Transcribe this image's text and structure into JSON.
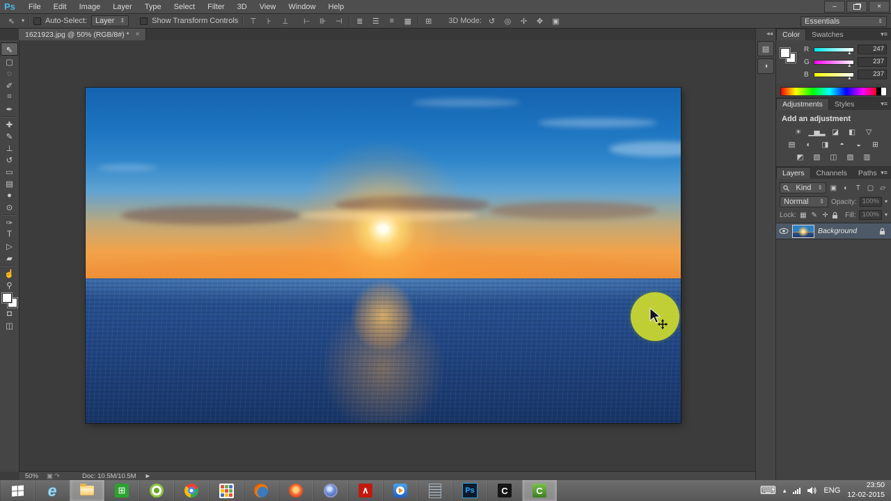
{
  "app": {
    "logo": "Ps"
  },
  "colors": {
    "cursor_halo": "#ccd92f",
    "ps_logo_blue": "#4db6e8",
    "selected_layer_bg": "#4d5966",
    "taskbar_gray": "#5f5f5f"
  },
  "window_controls": {
    "minimize": "–",
    "close": "×"
  },
  "menu_bar": {
    "items": [
      "File",
      "Edit",
      "Image",
      "Layer",
      "Type",
      "Select",
      "Filter",
      "3D",
      "View",
      "Window",
      "Help"
    ]
  },
  "options_bar": {
    "tool_glyph": "⇖",
    "tool_dropdown_glyph": "▾",
    "auto_select_label": "Auto-Select:",
    "auto_select_value": "Layer",
    "show_transform_label": "Show Transform Controls",
    "align_icons_v": [
      {
        "name": "align-top-edges",
        "glyph": "⊤"
      },
      {
        "name": "align-vertical-centers",
        "glyph": "⊦"
      },
      {
        "name": "align-bottom-edges",
        "glyph": "⊥"
      }
    ],
    "align_icons_h": [
      {
        "name": "align-left-edges",
        "glyph": "⊢"
      },
      {
        "name": "align-horizontal-centers",
        "glyph": "⊪"
      },
      {
        "name": "align-right-edges",
        "glyph": "⊣"
      }
    ],
    "distribute_icons": [
      {
        "name": "distribute-top-edges",
        "glyph": "≣"
      },
      {
        "name": "distribute-vertical-centers",
        "glyph": "☰"
      },
      {
        "name": "distribute-bottom-edges",
        "glyph": "≡"
      },
      {
        "name": "distribute-left-edges",
        "glyph": "▦"
      }
    ],
    "auto_align_icon": {
      "name": "auto-align-layers",
      "glyph": "⊞"
    },
    "mode_label": "3D Mode:",
    "mode_icons": [
      {
        "name": "3d-orbit",
        "glyph": "↺"
      },
      {
        "name": "3d-roll",
        "glyph": "◎"
      },
      {
        "name": "3d-drag",
        "glyph": "✢"
      },
      {
        "name": "3d-slide",
        "glyph": "✥"
      },
      {
        "name": "3d-scale",
        "glyph": "▣"
      }
    ],
    "workspace": "Essentials"
  },
  "document_tab": {
    "title": "1621923.jpg @ 50% (RGB/8#) *",
    "close_glyph": "×"
  },
  "toolbar": {
    "tools": [
      {
        "name": "move-tool",
        "glyph": "⇖",
        "selected": true
      },
      {
        "name": "rectangular-marquee-tool",
        "glyph": "▢"
      },
      {
        "name": "lasso-tool",
        "glyph": "◌"
      },
      {
        "name": "quick-selection-tool",
        "glyph": "✐"
      },
      {
        "name": "crop-tool",
        "glyph": "⌗"
      },
      {
        "name": "eyedropper-tool",
        "glyph": "✒"
      },
      {
        "name": "spot-healing-brush-tool",
        "glyph": "✚"
      },
      {
        "name": "brush-tool",
        "glyph": "✎"
      },
      {
        "name": "clone-stamp-tool",
        "glyph": "⊥"
      },
      {
        "name": "history-brush-tool",
        "glyph": "↺"
      },
      {
        "name": "eraser-tool",
        "glyph": "▭"
      },
      {
        "name": "gradient-tool",
        "glyph": "▤"
      },
      {
        "name": "blur-tool",
        "glyph": "●"
      },
      {
        "name": "dodge-tool",
        "glyph": "⊙"
      },
      {
        "name": "pen-tool",
        "glyph": "✑"
      },
      {
        "name": "type-tool",
        "glyph": "T"
      },
      {
        "name": "path-selection-tool",
        "glyph": "▷"
      },
      {
        "name": "rectangle-tool",
        "glyph": "▰"
      },
      {
        "name": "hand-tool",
        "glyph": "☝"
      },
      {
        "name": "zoom-tool",
        "glyph": "⚲"
      }
    ],
    "quick_mask_glyph": "◘",
    "screen_mode_glyph": "◫"
  },
  "dock_strip": {
    "collapse_glyph": "◂◂",
    "buttons": [
      {
        "name": "history-panel",
        "glyph": "▤"
      },
      {
        "name": "properties-panel",
        "glyph": "◑"
      }
    ]
  },
  "panels": {
    "color": {
      "tabs": [
        "Color",
        "Swatches"
      ],
      "menu_glyph": "▾≡",
      "channels": [
        {
          "label": "R",
          "value": "247"
        },
        {
          "label": "G",
          "value": "237"
        },
        {
          "label": "B",
          "value": "237"
        }
      ]
    },
    "adjustments": {
      "tabs": [
        "Adjustments",
        "Styles"
      ],
      "menu_glyph": "▾≡",
      "heading": "Add an adjustment",
      "rows": [
        [
          {
            "name": "brightness-contrast-adjustment",
            "glyph": "☀"
          },
          {
            "name": "levels-adjustment",
            "glyph": "▁▅▂"
          },
          {
            "name": "curves-adjustment",
            "glyph": "◪"
          },
          {
            "name": "exposure-adjustment",
            "glyph": "◧"
          },
          {
            "name": "vibrance-adjustment",
            "glyph": "▽"
          }
        ],
        [
          {
            "name": "hue-saturation-adjustment",
            "glyph": "▤"
          },
          {
            "name": "color-balance-adjustment",
            "glyph": "◐"
          },
          {
            "name": "black-white-adjustment",
            "glyph": "◨"
          },
          {
            "name": "photo-filter-adjustment",
            "glyph": "◓"
          },
          {
            "name": "channel-mixer-adjustment",
            "glyph": "◒"
          },
          {
            "name": "color-lookup-adjustment",
            "glyph": "⊞"
          }
        ],
        [
          {
            "name": "invert-adjustment",
            "glyph": "◩"
          },
          {
            "name": "posterize-adjustment",
            "glyph": "▧"
          },
          {
            "name": "threshold-adjustment",
            "glyph": "◫"
          },
          {
            "name": "selective-color-adjustment",
            "glyph": "▨"
          },
          {
            "name": "gradient-map-adjustment",
            "glyph": "▥"
          }
        ]
      ]
    },
    "layers": {
      "tabs": [
        "Layers",
        "Channels",
        "Paths"
      ],
      "menu_glyph": "▾≡",
      "filter_label": "Kind",
      "filter_icons": [
        {
          "name": "filter-pixel-layers",
          "glyph": "▣"
        },
        {
          "name": "filter-adjustment-layers",
          "glyph": "◐"
        },
        {
          "name": "filter-type-layers",
          "glyph": "T"
        },
        {
          "name": "filter-shape-layers",
          "glyph": "▢"
        },
        {
          "name": "filter-smart-objects",
          "glyph": "▱"
        }
      ],
      "blend_mode": "Normal",
      "opacity_label": "Opacity:",
      "opacity_value": "100%",
      "lock_label": "Lock:",
      "lock_icons": [
        {
          "name": "lock-transparent-pixels",
          "glyph": "▦"
        },
        {
          "name": "lock-image-pixels",
          "glyph": "✎"
        },
        {
          "name": "lock-position",
          "glyph": "✛"
        }
      ],
      "fill_label": "Fill:",
      "fill_value": "100%",
      "layer": {
        "name": "Background"
      }
    }
  },
  "status_bar": {
    "zoom": "50%",
    "doc": "Doc: 10.5M/10.5M",
    "expand_glyph": "►"
  },
  "taskbar": {
    "icons": [
      {
        "name": "start-button"
      },
      {
        "name": "internet-explorer",
        "glyph": "e"
      },
      {
        "name": "file-explorer",
        "active": true
      },
      {
        "name": "windows-store",
        "glyph": "⊞"
      },
      {
        "name": "green-circle-app"
      },
      {
        "name": "chrome"
      },
      {
        "name": "app-grid"
      },
      {
        "name": "firefox"
      },
      {
        "name": "torch-browser"
      },
      {
        "name": "blue-circle-app"
      },
      {
        "name": "adobe-reader",
        "glyph": "∧"
      },
      {
        "name": "media-player"
      },
      {
        "name": "notepad"
      },
      {
        "name": "photoshop",
        "glyph": "Ps"
      },
      {
        "name": "camtasia-studio",
        "glyph": "C"
      },
      {
        "name": "camtasia-recorder",
        "glyph": "C",
        "active": true
      }
    ],
    "tray": {
      "keyboard_glyph": "⌨",
      "hidden_icons_glyph": "▴",
      "language": "ENG",
      "time": "23:50",
      "date": "12-02-2015"
    }
  }
}
